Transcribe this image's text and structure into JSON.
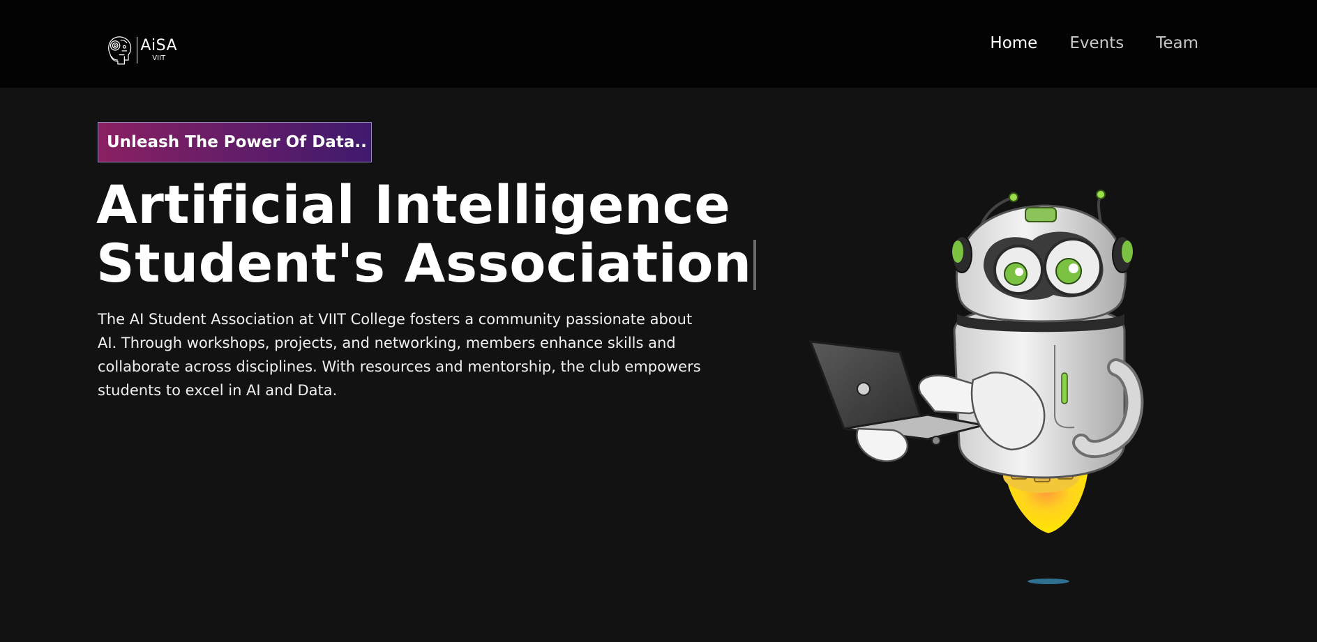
{
  "nav": {
    "logo": {
      "name": "AiSA",
      "sub": "VIIT"
    },
    "links": [
      {
        "label": "Home",
        "active": true
      },
      {
        "label": "Events",
        "active": false
      },
      {
        "label": "Team",
        "active": false
      }
    ]
  },
  "hero": {
    "tagline": "Unleash The Power Of Data..",
    "title_line1": "Artificial Intelligence",
    "title_line2": "Student's Association",
    "description": "The AI Student Association at VIIT College fosters a community passionate about AI. Through workshops, projects, and networking, members enhance skills and collaborate across disciplines. With resources and mentorship, the club empowers students to excel in AI and Data."
  },
  "colors": {
    "background": "#121212",
    "navbar": "#030303",
    "tagline_gradient_start": "#8a2062",
    "tagline_gradient_end": "#3f1a6e",
    "robot_accent": "#7bc142"
  },
  "icons": {
    "logo": "robot-head-logo-icon",
    "illustration": "robot-with-laptop-illustration"
  }
}
